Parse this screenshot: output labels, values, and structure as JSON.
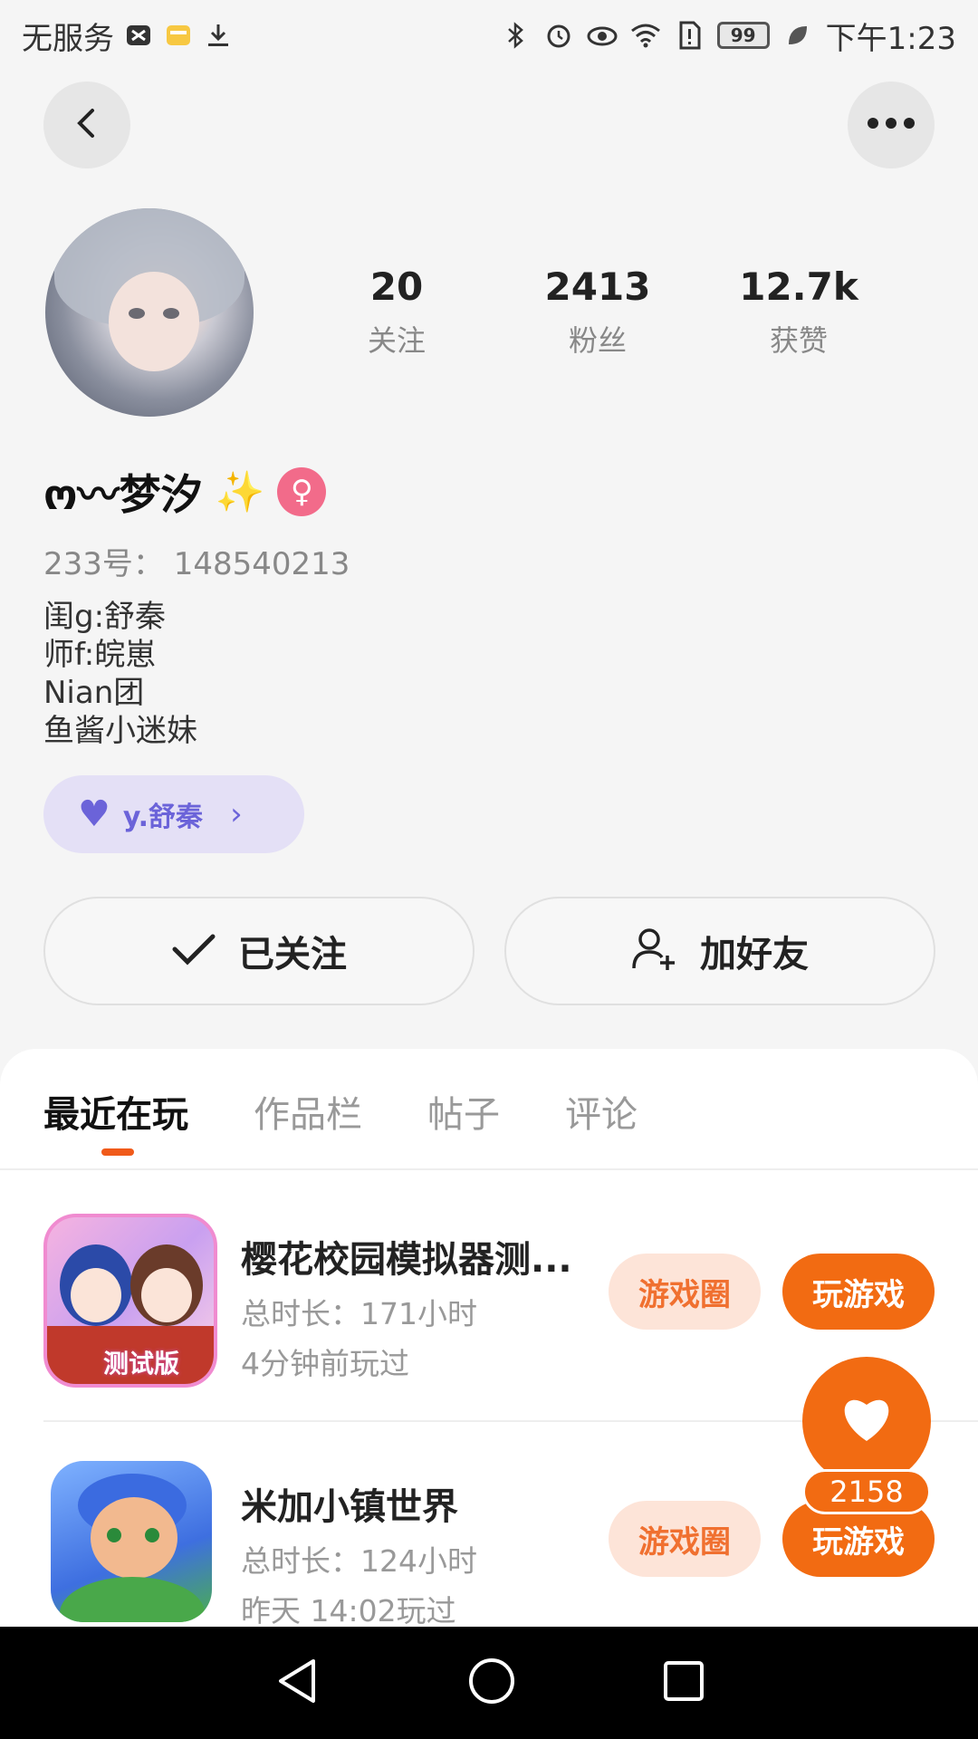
{
  "status_bar": {
    "carrier": "无服务",
    "battery": "99",
    "time": "下午1:23"
  },
  "profile": {
    "name": "ო〰梦汐",
    "uid": "233号： 148540213",
    "bio_lines": [
      "闺g:舒秦",
      "师f:皖崽",
      "Nian团",
      "鱼酱小迷妹"
    ],
    "cp_label": "y.舒秦",
    "stats": [
      {
        "value": "20",
        "label": "关注"
      },
      {
        "value": "2413",
        "label": "粉丝"
      },
      {
        "value": "12.7k",
        "label": "获赞"
      }
    ]
  },
  "actions": {
    "follow_label": "已关注",
    "add_friend_label": "加好友"
  },
  "tabs": [
    {
      "label": "最近在玩",
      "active": true
    },
    {
      "label": "作品栏",
      "active": false
    },
    {
      "label": "帖子",
      "active": false
    },
    {
      "label": "评论",
      "active": false
    }
  ],
  "games": [
    {
      "title": "樱花校园模拟器测...",
      "total_time": "总时长：171小时",
      "last_played": "4分钟前玩过",
      "circle_label": "游戏圈",
      "play_label": "玩游戏",
      "badge": "测试版"
    },
    {
      "title": "米加小镇世界",
      "total_time": "总时长：124小时",
      "last_played": "昨天 14:02玩过",
      "circle_label": "游戏圈",
      "play_label": "玩游戏"
    }
  ],
  "like_fab": {
    "count": "2158"
  },
  "colors": {
    "accent": "#f26b12",
    "cp": "#6b63d9",
    "gender": "#f26b8a"
  }
}
